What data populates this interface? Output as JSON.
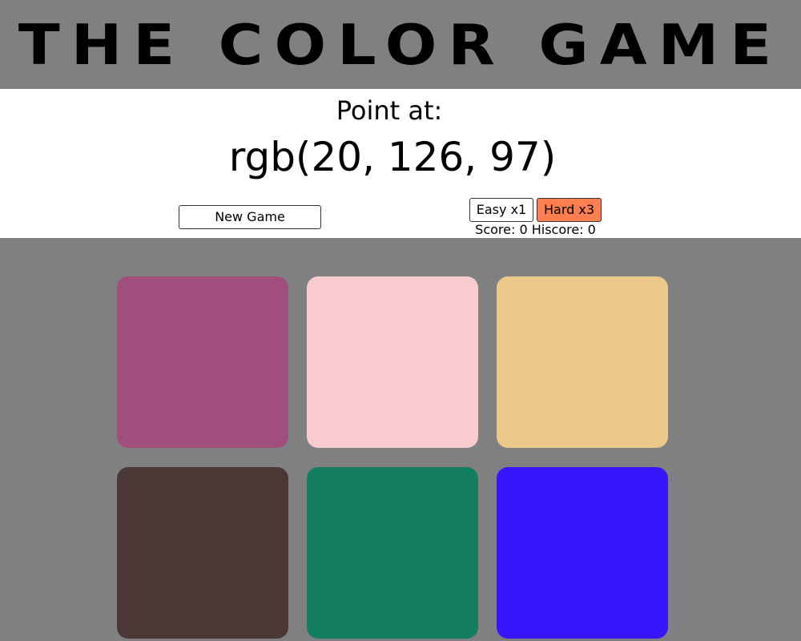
{
  "header": {
    "title": "THE COLOR GAME"
  },
  "prompt": {
    "label": "Point at:",
    "target": "rgb(20, 126, 97)"
  },
  "controls": {
    "new_game_label": "New Game",
    "easy_label": "Easy x1",
    "hard_label": "Hard x3",
    "selected_mode": "Hard x3",
    "selected_mode_color": "#ff7f50",
    "score_text": "Score: 0 Hiscore: 0"
  },
  "board": {
    "tiles": [
      {
        "color": "#a04e7c"
      },
      {
        "color": "#f7cbcf"
      },
      {
        "color": "#eac88a"
      },
      {
        "color": "#4c3737"
      },
      {
        "color": "#147e61"
      },
      {
        "color": "#3616ff"
      }
    ]
  }
}
